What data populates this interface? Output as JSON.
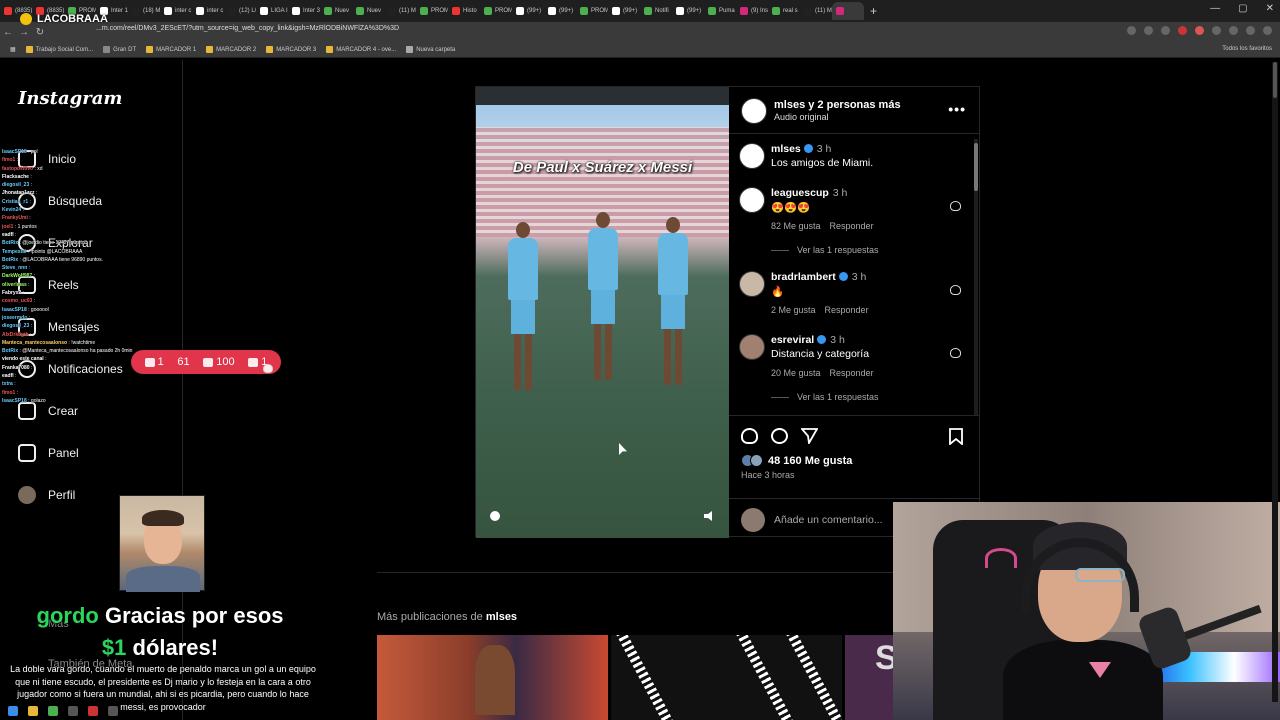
{
  "browser": {
    "tabs": [
      "(8835)",
      "(8835)",
      "PROM",
      "Inter 1",
      "(18) M",
      "inter c",
      "inter c",
      "(12) L/",
      "LIGA I",
      "Inter 3",
      "Nuev",
      "Nuev",
      "(11) M",
      "PROM",
      "Histo",
      "PROM",
      "(99+)",
      "(99+)",
      "PROM",
      "(99+)",
      "Notifi",
      "(99+)",
      "Puma",
      "(9) Ins",
      "real s",
      "(11) M",
      "",
      "+"
    ],
    "url": "...m.com/reel/DMv3_2EScET/?utm_source=ig_web_copy_link&igsh=MzRlODBiNWFlZA%3D%3D",
    "bookmarks": [
      "Trabajo Social Com...",
      "Gran DT",
      "MARCADOR 1",
      "MARCADOR 2",
      "MARCADOR 3",
      "MARCADOR 4 - ove...",
      "Nueva carpeta"
    ],
    "bookmarks_right": "Todos los favoritos"
  },
  "overlay": {
    "channel": "LACOBRAAA",
    "stats": {
      "comments": "1",
      "likes": "61",
      "viewers": "100",
      "followers": "1"
    },
    "chat": [
      {
        "user": "IsaacSP18",
        "msg": "pol"
      },
      {
        "user": "fimo1",
        "msg": ""
      },
      {
        "user": "fastopositivo",
        "msg": "xd"
      },
      {
        "user": "Flacksache",
        "msg": ""
      },
      {
        "user": "diegosil_23",
        "msg": ""
      },
      {
        "user": "Jhonatan1zzz",
        "msg": ""
      },
      {
        "user": "Cristian_r1",
        "msg": ""
      },
      {
        "user": "Kevin24",
        "msg": ""
      },
      {
        "user": "FrankyUmi",
        "msg": ""
      },
      {
        "user": "joel1",
        "msg": "1 puntos"
      },
      {
        "user": "eadfl",
        "msg": ""
      },
      {
        "user": "BotRix",
        "msg": "@joeldio tiene 19427 puntos."
      },
      {
        "user": "Tempestai",
        "msg": "!points @LACOBRAAA"
      },
      {
        "user": "BotRix",
        "msg": "@LACOBRAAA tiene 96890 puntos."
      },
      {
        "user": "Steve_nnn",
        "msg": ""
      },
      {
        "user": "DarkWolf987",
        "msg": ""
      },
      {
        "user": "oliverlmas",
        "msg": ""
      },
      {
        "user": "Fabryx2",
        "msg": ""
      },
      {
        "user": "cosmo_uc03",
        "msg": ""
      },
      {
        "user": "IsaacSP18",
        "msg": "goooool"
      },
      {
        "user": "joseermdo",
        "msg": ""
      },
      {
        "user": "diegosil_23",
        "msg": ""
      },
      {
        "user": "AlxDrk8gth",
        "msg": ""
      },
      {
        "user": "Manteca_mantecosaalonso",
        "msg": "!watchtime"
      },
      {
        "user": "BotRix",
        "msg": "@Manteca_mantecosaalonso ha pasado 2h 0min"
      },
      {
        "user": "viendo este canal",
        "msg": ""
      },
      {
        "user": "Franka7080",
        "msg": ""
      },
      {
        "user": "eadfl",
        "msg": ""
      },
      {
        "user": "txtra",
        "msg": ""
      },
      {
        "user": "fimo1",
        "msg": ""
      },
      {
        "user": "IsaacSP18",
        "msg": "golazo"
      }
    ],
    "alert_user": "gordo",
    "alert_text": "Gracias por esos",
    "alert_amount": "$1",
    "alert_currency": "dólares!",
    "tts": "La doble vara gordo, cuando el muerto de penaldo marca un gol a un equipo que ni tiene escudo, el presidente es Dj mario y lo festeja en la cara a otro jugador como si fuera un mundial, ahi si es picardia, pero cuando lo hace messi, es provocador"
  },
  "instagram": {
    "brand": "Instagram",
    "nav": [
      {
        "label": "Inicio",
        "icon": "home-icon"
      },
      {
        "label": "Búsqueda",
        "icon": "search-icon"
      },
      {
        "label": "Explorar",
        "icon": "compass-icon"
      },
      {
        "label": "Reels",
        "icon": "reels-icon"
      },
      {
        "label": "Mensajes",
        "icon": "messenger-icon"
      },
      {
        "label": "Notificaciones",
        "icon": "heart-icon"
      },
      {
        "label": "Crear",
        "icon": "plus-icon"
      },
      {
        "label": "Panel",
        "icon": "dashboard-icon"
      },
      {
        "label": "Perfil",
        "icon": "avatar-icon"
      }
    ],
    "more": "Más",
    "also_meta": "También de Meta",
    "post": {
      "video_title": "De Paul x Suárez x Messi",
      "header_names": "mlses y 2 personas más",
      "header_audio": "Audio original",
      "caption": {
        "user": "mlses",
        "time": "3 h",
        "text": "Los amigos de Miami."
      },
      "comments": [
        {
          "user": "leaguescup",
          "time": "3 h",
          "text": "😍😍😍",
          "likes": "82 Me gusta",
          "reply": "Responder",
          "view_replies": "Ver las 1 respuestas"
        },
        {
          "user": "bradrlambert",
          "time": "3 h",
          "text": "🔥",
          "likes": "2 Me gusta",
          "reply": "Responder",
          "view_replies": ""
        },
        {
          "user": "esreviral",
          "time": "3 h",
          "text": "Distancia y categoría",
          "likes": "20 Me gusta",
          "reply": "Responder",
          "view_replies": "Ver las 1 respuestas"
        }
      ],
      "like_count": "48 160 Me gusta",
      "posted_ago": "Hace 3 horas",
      "comment_placeholder": "Añade un comentario..."
    },
    "more_from_prefix": "Más publicaciones de",
    "more_from_user": "mlses"
  },
  "colors": {
    "accent": "#e0354a",
    "verified": "#3897f0",
    "alert_green": "#2bd65c"
  }
}
